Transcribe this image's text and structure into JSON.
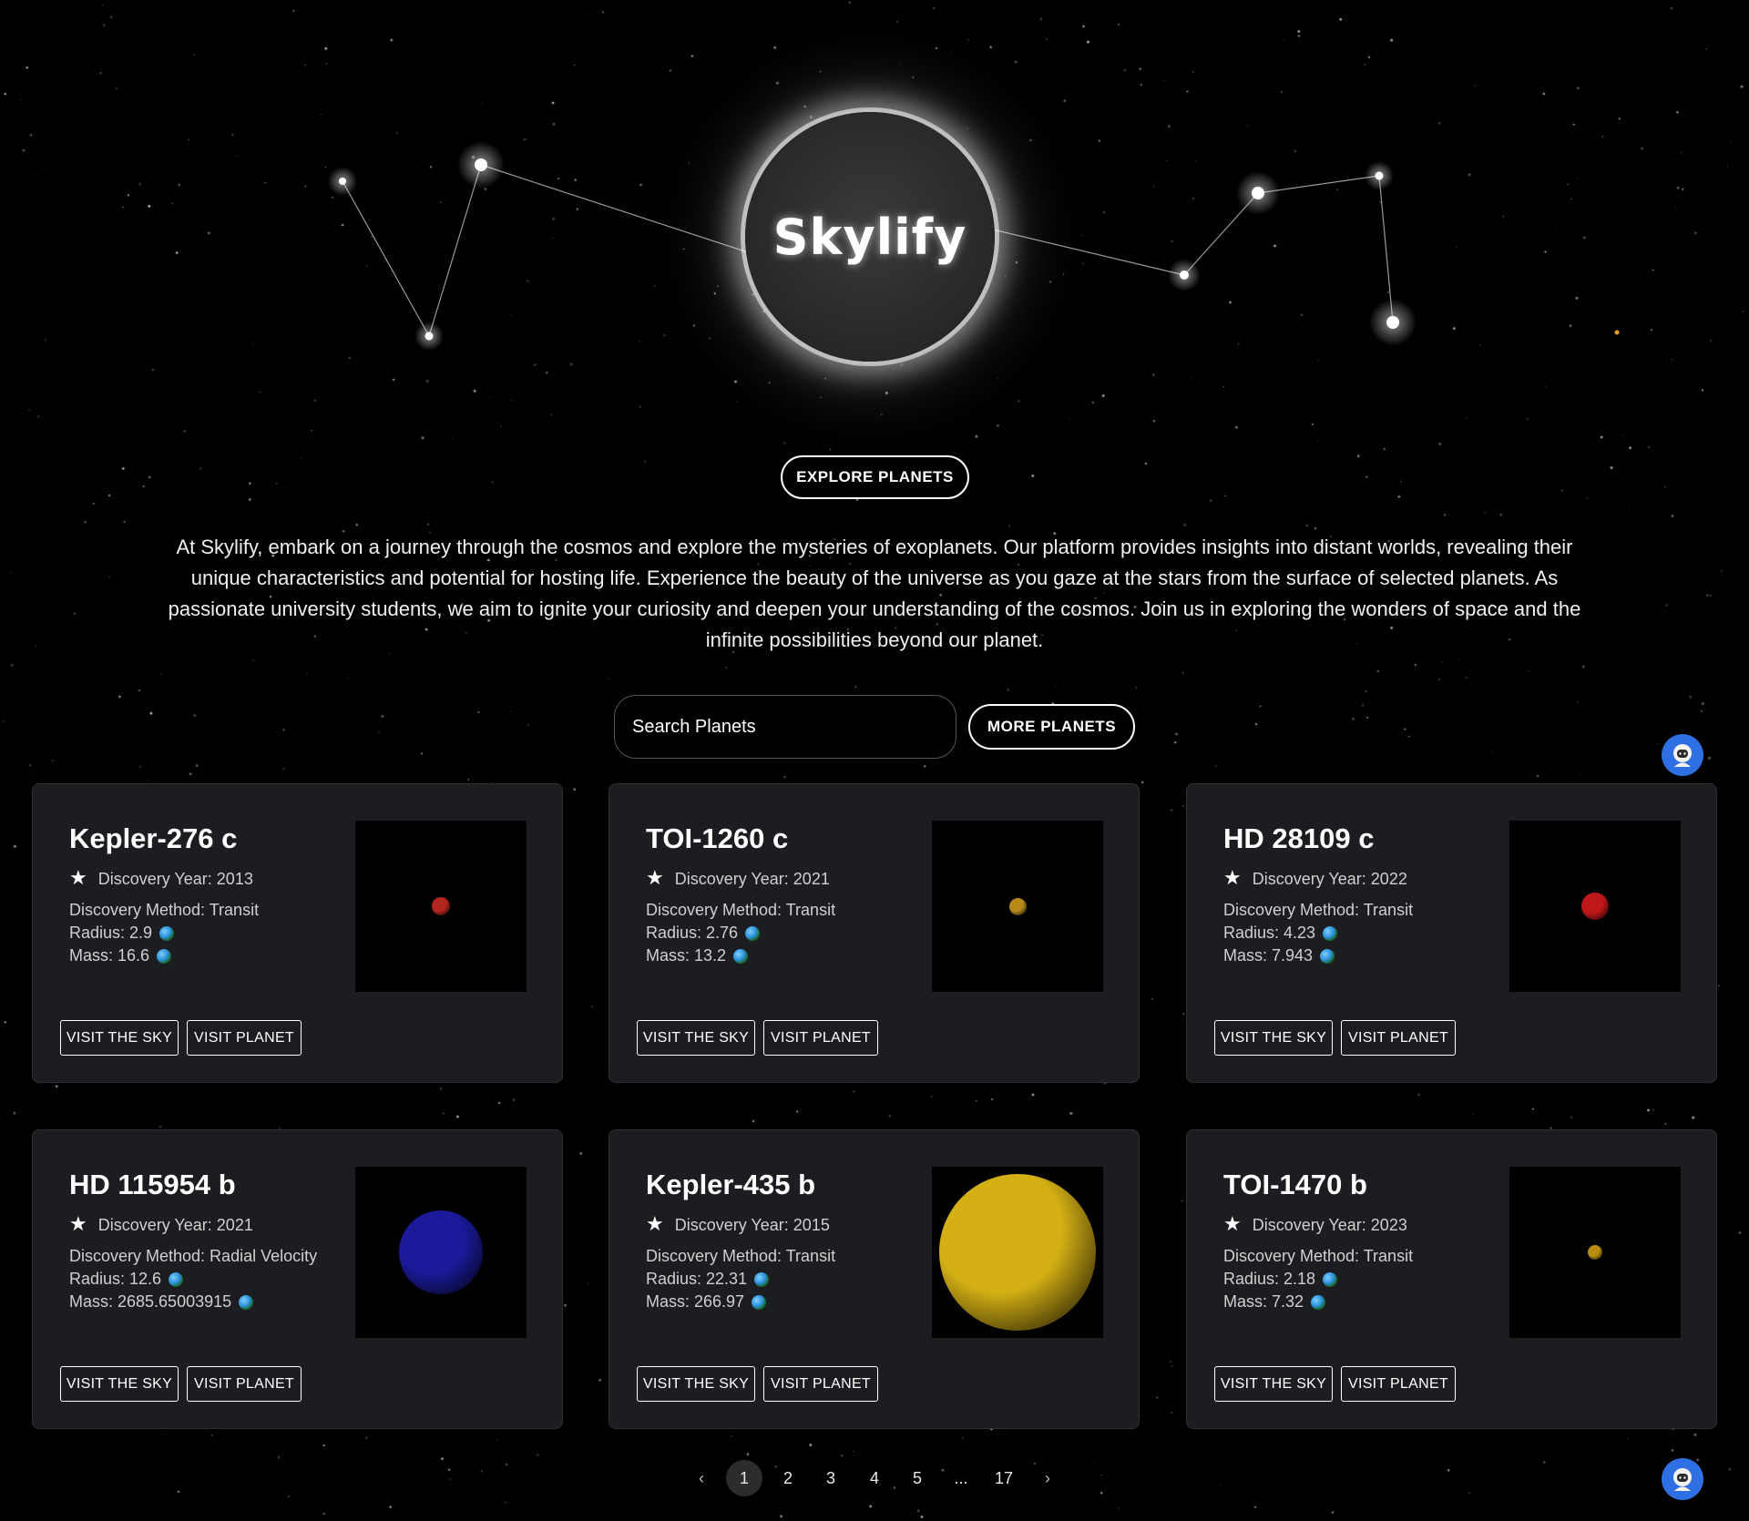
{
  "brand": {
    "logo_text": "Skylify"
  },
  "hero": {
    "explore_label": "EXPLORE PLANETS",
    "intro_text": "At Skylify, embark on a journey through the cosmos and explore the mysteries of exoplanets. Our platform provides insights into distant worlds, revealing their unique characteristics and potential for hosting life. Experience the beauty of the universe as you gaze at the stars from the surface of selected planets. As passionate university students, we aim to ignite your curiosity and deepen your understanding of the cosmos. Join us in exploring the wonders of space and the infinite possibilities beyond our planet."
  },
  "search": {
    "placeholder": "Search Planets",
    "value": ""
  },
  "more_planets_label": "MORE PLANETS",
  "cards": [
    {
      "name": "Kepler-276 c",
      "year": "Discovery Year: 2013",
      "method": "Discovery Method: Transit",
      "radius": "Radius: 2.9",
      "mass": "Mass: 16.6",
      "planet_color": "#b3261e"
    },
    {
      "name": "TOI-1260 c",
      "year": "Discovery Year: 2021",
      "method": "Discovery Method: Transit",
      "radius": "Radius: 2.76",
      "mass": "Mass: 13.2",
      "planet_color": "#b58a1a"
    },
    {
      "name": "HD 28109 c",
      "year": "Discovery Year: 2022",
      "method": "Discovery Method: Transit",
      "radius": "Radius: 4.23",
      "mass": "Mass: 7.943",
      "planet_color": "#c0181a"
    },
    {
      "name": "HD 115954 b",
      "year": "Discovery Year: 2021",
      "method": "Discovery Method: Radial Velocity",
      "radius": "Radius: 12.6",
      "mass": "Mass: 2685.65003915",
      "planet_color": "#1a1a9a"
    },
    {
      "name": "Kepler-435 b",
      "year": "Discovery Year: 2015",
      "method": "Discovery Method: Transit",
      "radius": "Radius: 22.31",
      "mass": "Mass: 266.97",
      "planet_color": "#d4b015"
    },
    {
      "name": "TOI-1470 b",
      "year": "Discovery Year: 2023",
      "method": "Discovery Method: Transit",
      "radius": "Radius: 2.18",
      "mass": "Mass: 7.32",
      "planet_color": "#b88d12"
    }
  ],
  "card_buttons": {
    "sky": "VISIT THE SKY",
    "planet": "VISIT PLANET"
  },
  "pagination": {
    "prev": "‹",
    "pages": [
      "1",
      "2",
      "3",
      "4",
      "5",
      "...",
      "17"
    ],
    "next": "›",
    "current": "1"
  },
  "colors": {
    "background": "#000000",
    "card_bg": "#1c1d20",
    "accent_avatar": "#2f6fe4"
  },
  "icons": {
    "star": "star-icon",
    "earth": "earth-icon",
    "avatar": "astronaut-icon"
  }
}
